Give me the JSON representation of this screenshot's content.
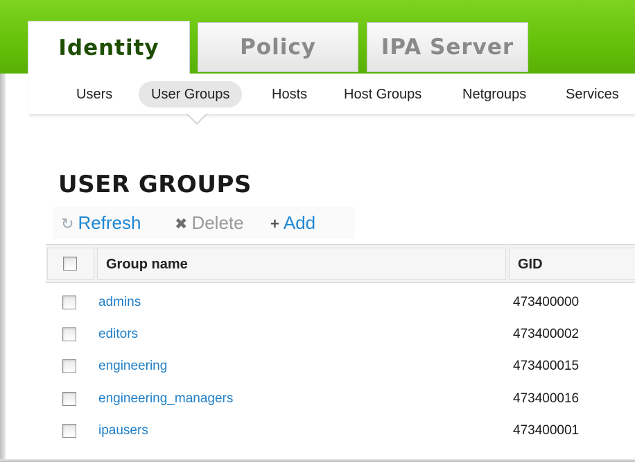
{
  "main_tabs": [
    {
      "label": "Identity",
      "active": true
    },
    {
      "label": "Policy",
      "active": false
    },
    {
      "label": "IPA Server",
      "active": false
    }
  ],
  "subnav": [
    {
      "label": "Users",
      "active": false
    },
    {
      "label": "User Groups",
      "active": true
    },
    {
      "label": "Hosts",
      "active": false
    },
    {
      "label": "Host Groups",
      "active": false
    },
    {
      "label": "Netgroups",
      "active": false
    },
    {
      "label": "Services",
      "active": false
    }
  ],
  "page_title": "USER GROUPS",
  "actions": {
    "refresh": {
      "label": "Refresh",
      "icon": "refresh-icon",
      "enabled": true
    },
    "delete": {
      "label": "Delete",
      "icon": "close-icon",
      "enabled": false
    },
    "add": {
      "label": "Add",
      "icon": "plus-icon",
      "enabled": true
    }
  },
  "table": {
    "columns": [
      "Group name",
      "GID"
    ],
    "rows": [
      {
        "name": "admins",
        "gid": "473400000"
      },
      {
        "name": "editors",
        "gid": "473400002"
      },
      {
        "name": "engineering",
        "gid": "473400015"
      },
      {
        "name": "engineering_managers",
        "gid": "473400016"
      },
      {
        "name": "ipausers",
        "gid": "473400001"
      }
    ]
  },
  "colors": {
    "header_green": "#67c20c",
    "link_blue": "#1f88d6",
    "active_tab_text": "#1f4e00"
  }
}
